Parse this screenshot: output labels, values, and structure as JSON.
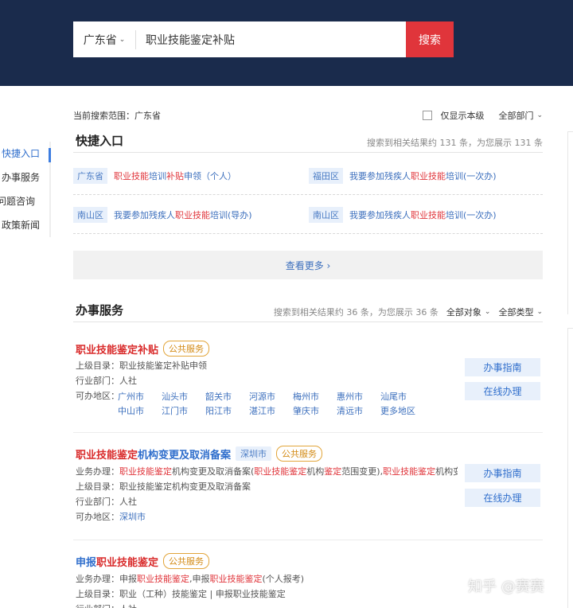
{
  "search": {
    "region": "广东省",
    "query": "职业技能鉴定补贴",
    "button": "搜索"
  },
  "scope": {
    "label": "当前搜索范围：广东省",
    "only_this_level": "仅显示本级",
    "dept_filter": "全部部门"
  },
  "left_nav": [
    {
      "label": "快捷入口"
    },
    {
      "label": "办事服务"
    },
    {
      "label": "问题咨询"
    },
    {
      "label": "政策新闻"
    }
  ],
  "quick": {
    "title": "快捷入口",
    "stats": "搜索到相关结果约 131 条，为您展示 131 条",
    "items": [
      {
        "region": "广东省",
        "pre": "",
        "hl": "职业技能",
        "mid": "培训",
        "hl2": "补贴",
        "post": "申领（个人）"
      },
      {
        "region": "福田区",
        "pre": "我要参加残疾人",
        "hl": "职业技能",
        "mid": "培训(一次办)",
        "hl2": "",
        "post": ""
      },
      {
        "region": "南山区",
        "pre": "我要参加残疾人",
        "hl": "职业技能",
        "mid": "培训(导办)",
        "hl2": "",
        "post": ""
      },
      {
        "region": "南山区",
        "pre": "我要参加残疾人",
        "hl": "职业技能",
        "mid": "培训(一次办)",
        "hl2": "",
        "post": ""
      }
    ],
    "more": "查看更多 ›"
  },
  "services": {
    "title": "办事服务",
    "stats": "搜索到相关结果约 36 条，为您展示 36 条",
    "filter_target": "全部对象",
    "filter_type": "全部类型",
    "guide_btn": "办事指南",
    "online_btn": "在线办理",
    "items": [
      {
        "title_pre": "",
        "title_hl": "职业技能鉴定补贴",
        "title_post": "",
        "region_badge": "",
        "public_badge": "公共服务",
        "catalog": "上级目录：职业技能鉴定补贴申领",
        "dept": "行业部门：人社",
        "area_label": "可办地区：",
        "cities": [
          "广州市",
          "汕头市",
          "韶关市",
          "河源市",
          "梅州市",
          "惠州市",
          "汕尾市",
          "中山市",
          "江门市",
          "阳江市",
          "湛江市",
          "肇庆市",
          "清远市",
          "更多地区"
        ]
      },
      {
        "title_pre": "",
        "title_hl": "职业技能鉴定",
        "title_post": "机构变更及取消备案",
        "region_badge": "深圳市",
        "public_badge": "公共服务",
        "business_label": "业务办理：",
        "business_parts": [
          {
            "t": "职业技能鉴定",
            "h": true
          },
          {
            "t": "机构变更及取消备案(",
            "h": false
          },
          {
            "t": "职业技能鉴定",
            "h": true
          },
          {
            "t": "机构",
            "h": false
          },
          {
            "t": "鉴定",
            "h": true
          },
          {
            "t": "范围变更),",
            "h": false
          },
          {
            "t": "职业技能鉴定",
            "h": true
          },
          {
            "t": "机构变更及...",
            "h": false
          }
        ],
        "catalog": "上级目录：职业技能鉴定机构变更及取消备案",
        "dept": "行业部门：人社",
        "area_label": "可办地区：",
        "area_value": "深圳市"
      },
      {
        "title_pre": "申报",
        "title_hl": "职业技能鉴定",
        "title_post": "",
        "region_badge": "",
        "public_badge": "公共服务",
        "business_label": "业务办理：",
        "business_parts": [
          {
            "t": "申报",
            "h": false
          },
          {
            "t": "职业技能鉴定",
            "h": true
          },
          {
            "t": ",申报",
            "h": false
          },
          {
            "t": "职业技能鉴定",
            "h": true
          },
          {
            "t": "(个人报考)",
            "h": false
          }
        ],
        "catalog": "上级目录：职业（工种）技能鉴定 | 申报职业技能鉴定",
        "dept": "行业部门：人社"
      }
    ]
  },
  "watermark": "知乎 @赛赛"
}
